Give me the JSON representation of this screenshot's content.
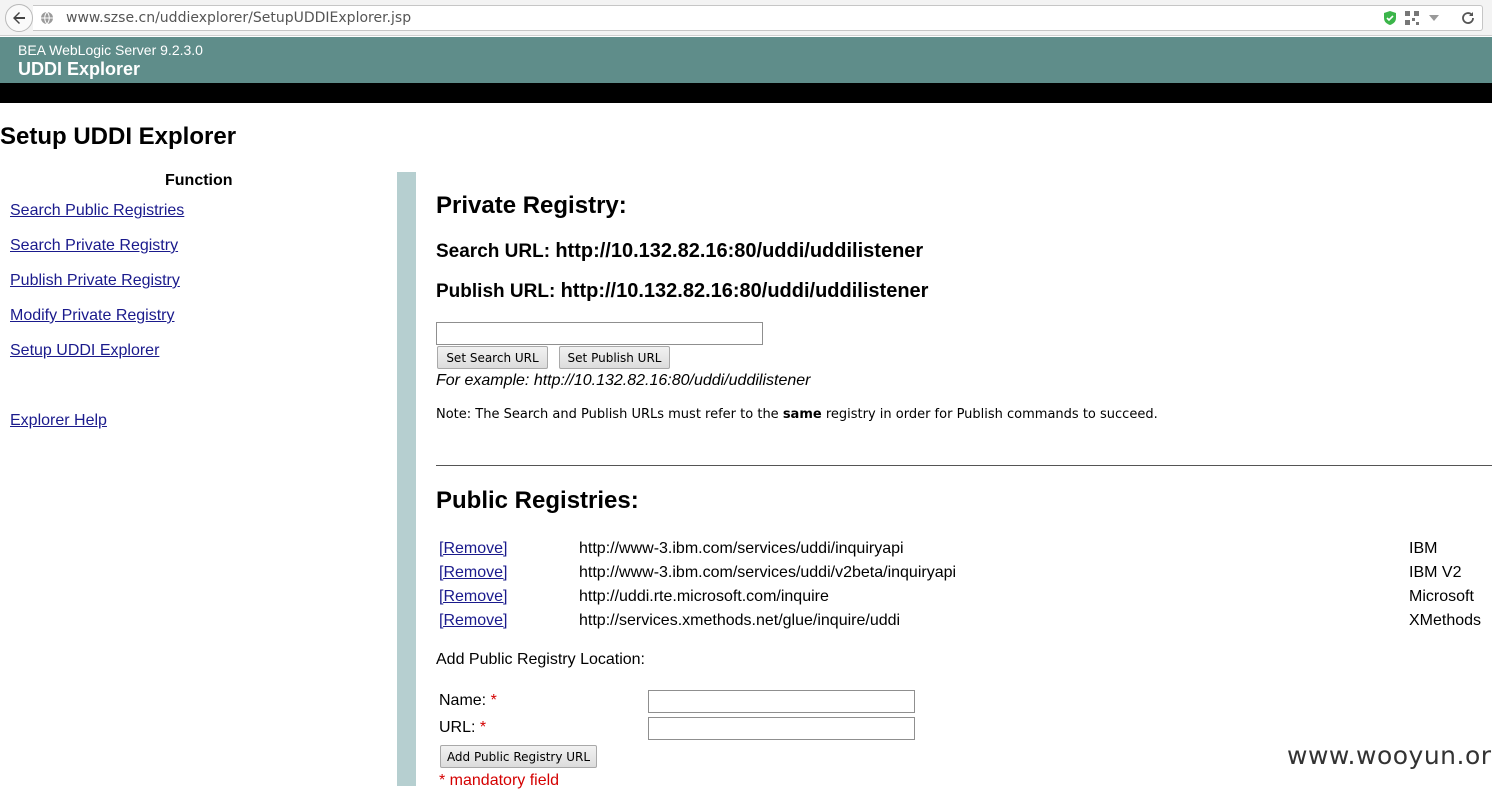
{
  "browser": {
    "url": "www.szse.cn/uddiexplorer/SetupUDDIExplorer.jsp"
  },
  "banner": {
    "product": "BEA WebLogic Server 9.2.3.0",
    "title": "UDDI Explorer"
  },
  "page": {
    "title": "Setup UDDI Explorer"
  },
  "nav": {
    "heading": "Function",
    "links": [
      "Search Public Registries",
      "Search Private Registry",
      "Publish Private Registry",
      "Modify Private Registry",
      "Setup UDDI Explorer"
    ],
    "help": "Explorer Help"
  },
  "private_registry": {
    "heading": "Private Registry:",
    "search_label": "Search URL:",
    "search_url": "http://10.132.82.16:80/uddi/uddilistener",
    "publish_label": "Publish URL:",
    "publish_url": "http://10.132.82.16:80/uddi/uddilistener",
    "url_input_value": "",
    "set_search_button": "Set Search URL",
    "set_publish_button": "Set Publish URL",
    "example": "For example: http://10.132.82.16:80/uddi/uddilistener",
    "note_before": "Note: The Search and Publish URLs must refer to the ",
    "note_bold": "same",
    "note_after": " registry in order for Publish commands to succeed."
  },
  "public_registries": {
    "heading": "Public Registries:",
    "remove_label": "[Remove]",
    "rows": [
      {
        "url": "http://www-3.ibm.com/services/uddi/inquiryapi",
        "name": "IBM"
      },
      {
        "url": "http://www-3.ibm.com/services/uddi/v2beta/inquiryapi",
        "name": "IBM V2"
      },
      {
        "url": "http://uddi.rte.microsoft.com/inquire",
        "name": "Microsoft"
      },
      {
        "url": "http://services.xmethods.net/glue/inquire/uddi",
        "name": "XMethods"
      }
    ],
    "add_label": "Add Public Registry Location:",
    "name_label": "Name:",
    "url_label": "URL:",
    "required_mark": "*",
    "name_value": "",
    "url_value": "",
    "add_button": "Add Public Registry URL",
    "mandatory_note": "* mandatory field"
  },
  "watermark": "www.wooyun.org",
  "colors": {
    "banner": "#5f8d8a",
    "divider": "#b6cfd0",
    "link": "#1a1a8c",
    "required": "#d40000"
  }
}
